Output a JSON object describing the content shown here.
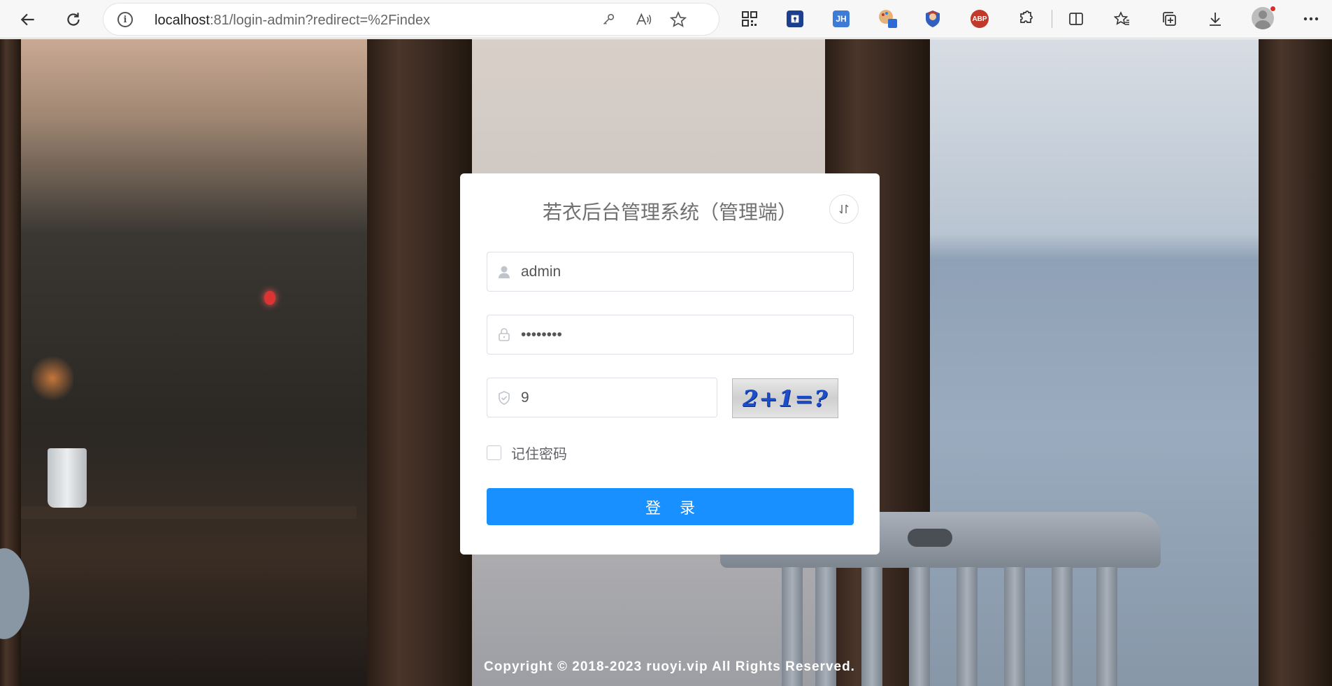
{
  "browser": {
    "url_host": "localhost",
    "url_rest": ":81/login-admin?redirect=%2Findex",
    "extensions": [
      {
        "name": "qr-code-icon"
      },
      {
        "name": "password-manager-icon"
      },
      {
        "label": "JH",
        "color": "#3d7bd9"
      },
      {
        "name": "paint-palette-icon"
      },
      {
        "name": "shield-avatar-icon"
      },
      {
        "label": "ABP",
        "color": "#c0392b"
      }
    ]
  },
  "login": {
    "title": "若衣后台管理系统（管理端）",
    "username_value": "admin",
    "password_value": "12345678",
    "captcha_value": "9",
    "captcha_text": "2+1=?",
    "remember_label": "记住密码",
    "submit_label": "登 录"
  },
  "footer": {
    "copyright": "Copyright © 2018-2023 ruoyi.vip All Rights Reserved."
  },
  "colors": {
    "primary": "#1890ff",
    "card_bg": "#ffffff",
    "title_text": "#707070"
  }
}
